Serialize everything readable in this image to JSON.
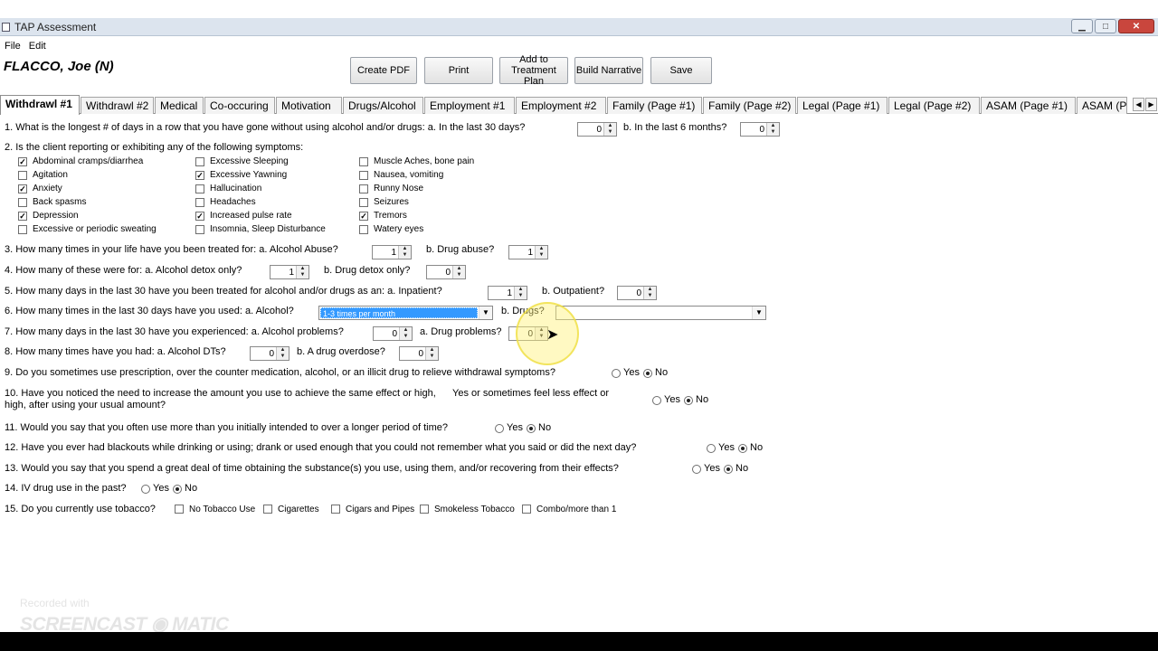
{
  "window": {
    "title": "TAP Assessment"
  },
  "menu": [
    "File",
    "Edit"
  ],
  "patient_name": "FLACCO, Joe (N)",
  "toolbar": {
    "create_pdf": "Create PDF",
    "print": "Print",
    "add_treatment": "Add to\nTreatment Plan",
    "build_narrative": "Build Narrative",
    "save": "Save"
  },
  "tabs": [
    "Withdrawl #1",
    "Withdrawl #2",
    "Medical",
    "Co-occuring",
    "Motivation",
    "Drugs/Alcohol",
    "Employment #1",
    "Employment #2",
    "Family (Page #1)",
    "Family (Page #2)",
    "Legal (Page #1)",
    "Legal (Page #2)",
    "ASAM (Page #1)",
    "ASAM (P"
  ],
  "q1": {
    "text": "1. What is the longest # of days in a row that you have gone without using alcohol and/or drugs:  a. In the last 30 days?",
    "b": "b. In the last 6 months?",
    "a_value": "0",
    "b_value": "0"
  },
  "q2": {
    "text": "2. Is the client reporting or exhibiting any of the following symptoms:",
    "symptoms": [
      {
        "label": "Abdominal cramps/diarrhea",
        "checked": true
      },
      {
        "label": "Agitation",
        "checked": false
      },
      {
        "label": "Anxiety",
        "checked": true
      },
      {
        "label": "Back spasms",
        "checked": false
      },
      {
        "label": "Depression",
        "checked": true
      },
      {
        "label": "Excessive or periodic sweating",
        "checked": false
      },
      {
        "label": "Excessive Sleeping",
        "checked": false
      },
      {
        "label": "Excessive Yawning",
        "checked": true
      },
      {
        "label": "Hallucination",
        "checked": false
      },
      {
        "label": "Headaches",
        "checked": false
      },
      {
        "label": "Increased pulse rate",
        "checked": true
      },
      {
        "label": "Insomnia, Sleep Disturbance",
        "checked": false
      },
      {
        "label": "Muscle Aches, bone pain",
        "checked": false
      },
      {
        "label": "Nausea, vomiting",
        "checked": false
      },
      {
        "label": "Runny Nose",
        "checked": false
      },
      {
        "label": "Seizures",
        "checked": false
      },
      {
        "label": "Tremors",
        "checked": true
      },
      {
        "label": "Watery eyes",
        "checked": false
      }
    ]
  },
  "q3": {
    "text": "3. How many times in your life have you been treated for:  a. Alcohol Abuse?",
    "b": "b.  Drug abuse?",
    "a_value": "1",
    "b_value": "1"
  },
  "q4": {
    "text": "4. How many of these were for:  a. Alcohol detox only?",
    "b": "b. Drug detox only?",
    "a_value": "1",
    "b_value": "0"
  },
  "q5": {
    "text": "5. How many days in the last 30 have you been treated for alcohol and/or drugs as an:   a. Inpatient?",
    "b": "b. Outpatient?",
    "a_value": "1",
    "b_value": "0"
  },
  "q6": {
    "text": "6. How many times in the last 30 days have you used:  a. Alcohol?",
    "b": "b. Drugs?",
    "a_value": "1-3 times per month",
    "b_value": ""
  },
  "q7": {
    "text": "7. How many days in the last 30 have you experienced:  a. Alcohol problems?",
    "b": "a. Drug problems?",
    "a_value": "0",
    "b_value": "0"
  },
  "q8": {
    "text": "8. How many times have you had:    a. Alcohol DTs?",
    "b": "b. A drug overdose?",
    "a_value": "0",
    "b_value": "0"
  },
  "q9": {
    "text": "9. Do you sometimes use prescription, over the counter medication, alcohol, or an illicit drug to relieve withdrawal symptoms?",
    "answer": "No"
  },
  "q10": {
    "line1": "10. Have you noticed the need to increase the amount you use to achieve the same effect or high,",
    "line2": "high, after using your usual amount?",
    "answer": "No"
  },
  "q11": {
    "text": "11. Would you say that you often use more than you initially intended to over a longer period of time?",
    "answer": "No"
  },
  "q12": {
    "text": "12. Have you ever had blackouts while drinking or using; drank or used enough that you could not remember what you said or did the next day?",
    "answer": "No"
  },
  "q13": {
    "text": "13. Would you say that you spend a great deal of time obtaining the substance(s) you use, using them, and/or recovering from their effects?",
    "answer": "No"
  },
  "q14": {
    "text": "14. IV drug use in the past?",
    "answer": "No"
  },
  "q15": {
    "text": "15. Do you currently use tobacco?",
    "options": [
      "No Tobacco Use",
      "Cigarettes",
      "Cigars and Pipes",
      "Smokeless Tobacco",
      "Combo/more than 1"
    ]
  },
  "radio_labels": {
    "yes": "Yes",
    "no": "No"
  },
  "q10_extra": "Yes or sometimes feel less effect or",
  "watermark": {
    "line1": "Recorded with",
    "line2": "SCREENCAST",
    "line3": "MATIC"
  }
}
